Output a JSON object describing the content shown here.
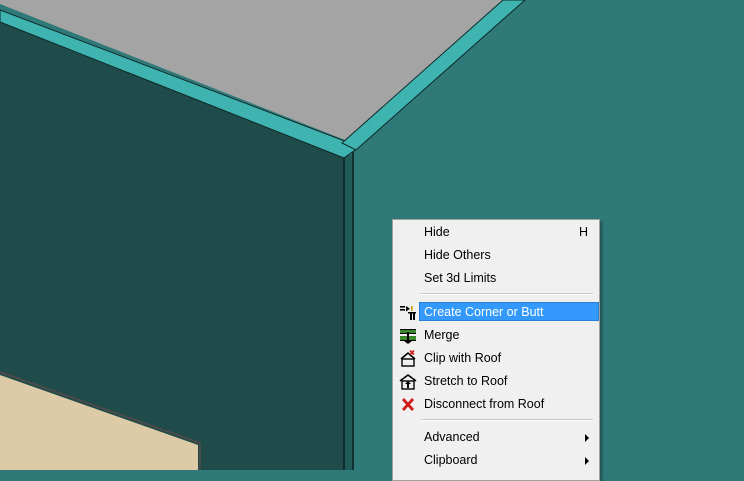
{
  "menu": {
    "items": [
      {
        "label": "Hide",
        "shortcut": "H"
      },
      {
        "label": "Hide Others"
      },
      {
        "label": "Set 3d Limits"
      },
      {
        "label": "Create Corner or Butt",
        "icon": "create-corner-icon",
        "selected": true
      },
      {
        "label": "Merge",
        "icon": "merge-icon"
      },
      {
        "label": "Clip with Roof",
        "icon": "clip-roof-icon"
      },
      {
        "label": "Stretch to Roof",
        "icon": "stretch-roof-icon"
      },
      {
        "label": "Disconnect from Roof",
        "icon": "disconnect-icon"
      },
      {
        "label": "Advanced",
        "submenu": true
      },
      {
        "label": "Clipboard",
        "submenu": true
      }
    ]
  },
  "colors": {
    "background_wall": "#2f7a79",
    "dark_wall": "#1f4b4a",
    "wall_edge": "#3fb3b0",
    "roof_top": "#a0a0a0",
    "floor": "#dccba6",
    "menu_bg": "#f0f0f0",
    "highlight": "#3399ff",
    "disconnect_x": "#d11a1a"
  }
}
